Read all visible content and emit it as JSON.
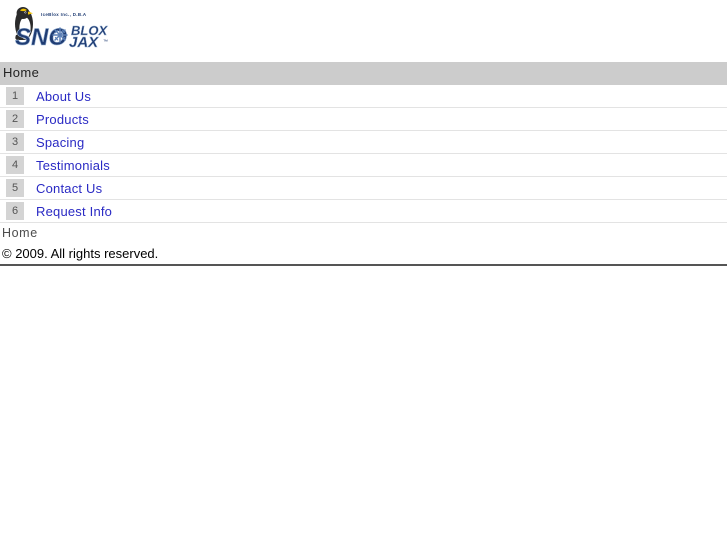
{
  "brand": {
    "tagline": "IceBlox Inc., D.B.A",
    "wordmark_primary": "SNO",
    "wordmark_secondary": "BLOX",
    "wordmark_tertiary": "JAX",
    "trademark": "™",
    "logo_icon": "penguin-snowflake-logo",
    "colors": {
      "wordmark_dark": "#1f3c73",
      "wordmark_light": "#9bb4d4",
      "tagline": "#1f3c73",
      "penguin_body": "#2b2b2b",
      "penguin_beak": "#f2c200",
      "penguin_belly": "#ffffff"
    }
  },
  "nav": {
    "header_label": "Home",
    "items": [
      {
        "marker": "1",
        "label": "About Us"
      },
      {
        "marker": "2",
        "label": "Products"
      },
      {
        "marker": "3",
        "label": "Spacing"
      },
      {
        "marker": "4",
        "label": "Testimonials"
      },
      {
        "marker": "5",
        "label": "Contact Us"
      },
      {
        "marker": "6",
        "label": "Request Info"
      }
    ]
  },
  "footer": {
    "nav_label": "Home",
    "copyright": "© 2009. All rights reserved."
  },
  "colors": {
    "link": "#2a2ac4",
    "nav_header_bg": "#cccccc",
    "marker_bg": "#d4d4d4",
    "row_border": "#e3e3e3",
    "page_bg": "#ffffff"
  }
}
